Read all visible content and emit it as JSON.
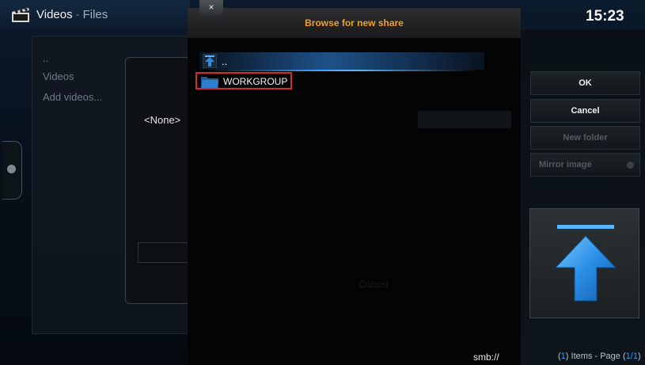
{
  "header": {
    "app_icon": "clapperboard-icon",
    "title": "Videos",
    "separator": "-",
    "subtitle": "Files",
    "clock": "15:23"
  },
  "background": {
    "list_items": [
      "..",
      "Videos",
      "Add videos..."
    ],
    "source_value": "<None>",
    "dimmed_cancel": "Cancel"
  },
  "dialog": {
    "title": "Browse for new share",
    "close_label": "×",
    "items": [
      {
        "label": "..",
        "icon": "parent-folder-arrow-icon"
      },
      {
        "label": "WORKGROUP",
        "icon": "network-folder-icon"
      }
    ],
    "current_path": "smb://"
  },
  "actions": {
    "ok": "OK",
    "cancel": "Cancel",
    "new_folder": "New folder",
    "mirror_image": "Mirror image"
  },
  "thumbnail": {
    "icon": "up-arrow-icon"
  },
  "footer": {
    "items_count": "1",
    "items_label": "Items - Page",
    "page_current": "1",
    "page_total": "1"
  },
  "colors": {
    "accent_blue": "#2a9cff",
    "title_orange": "#f0a020",
    "highlight_outline": "#d22c2c"
  }
}
